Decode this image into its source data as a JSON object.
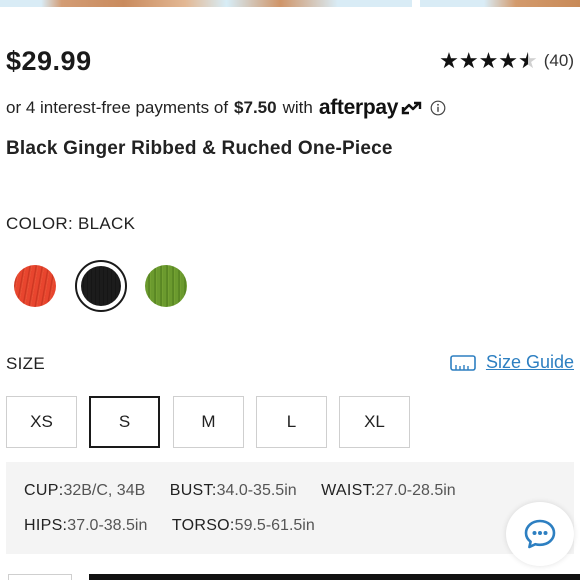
{
  "product": {
    "price": "$29.99",
    "title": "Black Ginger Ribbed & Ruched One-Piece"
  },
  "rating": {
    "stars_value": 4.5,
    "stars_max": 5,
    "review_count": "(40)"
  },
  "afterpay": {
    "prefix": "or 4 interest-free payments of",
    "amount": "$7.50",
    "with": "with",
    "logo_text": "afterpay"
  },
  "color": {
    "label": "COLOR: BLACK",
    "swatches": [
      {
        "name": "red",
        "hex": "#e8452e"
      },
      {
        "name": "black",
        "hex": "#1c1c1c",
        "selected": true
      },
      {
        "name": "green",
        "hex": "#6b9a2e"
      }
    ]
  },
  "size": {
    "label": "SIZE",
    "guide_label": "Size Guide",
    "options": [
      "XS",
      "S",
      "M",
      "L",
      "XL"
    ],
    "selected": "S"
  },
  "measurements": {
    "row1": [
      {
        "key": "CUP",
        "value": "32B/C, 34B"
      },
      {
        "key": "BUST",
        "value": "34.0-35.5in"
      },
      {
        "key": "WAIST",
        "value": "27.0-28.5in"
      }
    ],
    "row2": [
      {
        "key": "HIPS",
        "value": "37.0-38.5in"
      },
      {
        "key": "TORSO",
        "value": "59.5-61.5in"
      }
    ]
  },
  "colors": {
    "link_blue": "#2d7fc1",
    "text_dark": "#1a1a1a",
    "measure_bg": "#f4f4f4"
  }
}
